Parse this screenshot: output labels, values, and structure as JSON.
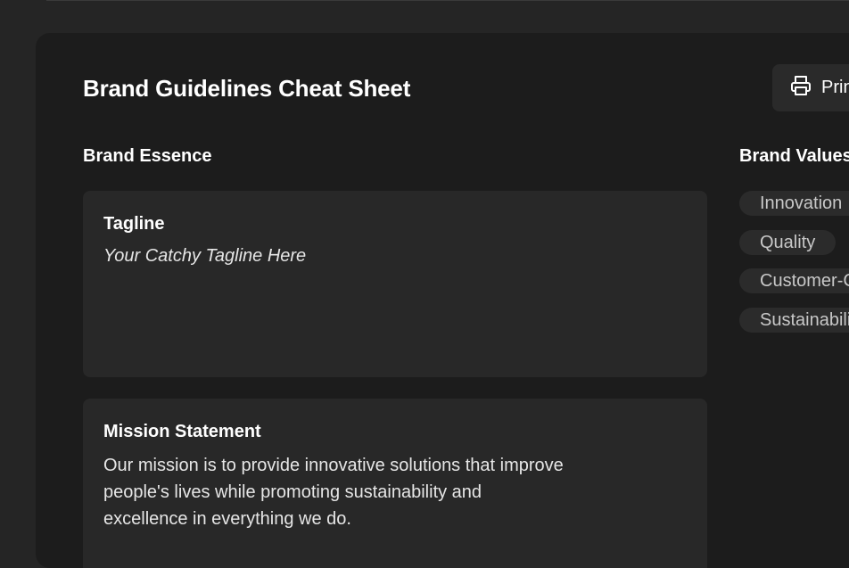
{
  "header": {
    "title": "Brand Guidelines Cheat Sheet",
    "print_label": "Print"
  },
  "sections": {
    "essence_heading": "Brand Essence",
    "values_heading": "Brand Values"
  },
  "tagline": {
    "title": "Tagline",
    "text": "Your Catchy Tagline Here"
  },
  "mission": {
    "title": "Mission Statement",
    "text": "Our mission is to provide innovative solutions that improve people's lives while promoting sustainability and excellence in everything we do."
  },
  "values": [
    "Innovation",
    "Quality",
    "Customer-Centricity",
    "Sustainability"
  ],
  "icons": {
    "print": "printer-icon"
  }
}
